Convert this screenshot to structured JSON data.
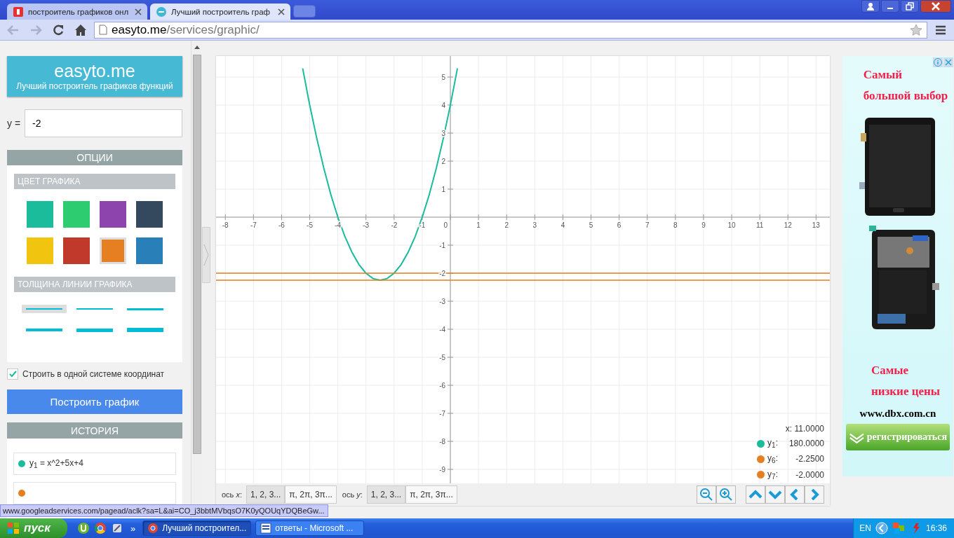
{
  "browser": {
    "tabs": [
      {
        "title": "построитель графиков онл",
        "selected": false
      },
      {
        "title": "Лучший построитель граф",
        "selected": true
      }
    ],
    "url_host": "easyto.me",
    "url_path": "/services/graphic/"
  },
  "sidebar": {
    "logo_title": "easyto.me",
    "logo_subtitle": "Лучший построитель графиков функций",
    "input_label": "y =",
    "input_value": "-2",
    "options_header": "ОПЦИИ",
    "color_header": "ЦВЕТ ГРАФИКА",
    "colors": [
      {
        "color": "#1abc9c",
        "selected": false
      },
      {
        "color": "#2ecc71",
        "selected": false
      },
      {
        "color": "#8e44ad",
        "selected": false
      },
      {
        "color": "#34495e",
        "selected": false
      },
      {
        "color": "#f1c40f",
        "selected": false
      },
      {
        "color": "#c0392b",
        "selected": false
      },
      {
        "color": "#e67e22",
        "selected": true
      },
      {
        "color": "#2980b9",
        "selected": false
      }
    ],
    "thickness_header": "ТОЛЩИНА ЛИНИИ ГРАФИКА",
    "thickness": [
      {
        "selected": true
      },
      {
        "selected": false
      },
      {
        "selected": false
      },
      {
        "selected": false
      },
      {
        "selected": false
      },
      {
        "selected": false
      }
    ],
    "same_axes": {
      "label": "Строить в одной системе координат",
      "checked": true
    },
    "build_button": "Построить график",
    "history_header": "ИСТОРИЯ",
    "history": [
      {
        "label": "y$_{1}$ = x^2+5x+4",
        "color": "#1abc9c"
      },
      {
        "color": "#e67e22"
      }
    ]
  },
  "chart": {
    "chart_data": {
      "type": "line",
      "grid": true,
      "legend": "lower right",
      "x": [
        -8.33,
        -5.25,
        -5,
        -4.75,
        -4.5,
        -4.25,
        -4,
        -3.75,
        -3.5,
        -3.25,
        -3,
        -2.75,
        -2.5,
        -2.25,
        -2,
        -1.75,
        -1.5,
        -1.25,
        -1,
        -0.75,
        -0.5,
        -0.25,
        0,
        0.25,
        13.49
      ],
      "series": [
        {
          "name": "y$_{1}$",
          "color": "#1abc9c",
          "values": [
            null,
            5.31,
            4,
            2.81,
            1.75,
            0.81,
            0,
            -0.69,
            -1.25,
            -1.69,
            -2,
            -2.19,
            -2.25,
            -2.19,
            -2,
            -1.69,
            -1.25,
            -0.69,
            0,
            0.81,
            1.75,
            2.81,
            4,
            5.31,
            null
          ]
        },
        {
          "name": "y$_{6}$",
          "color": "#e67e22",
          "values": [
            -2.25,
            -2.25,
            -2.25,
            -2.25,
            -2.25,
            -2.25,
            -2.25,
            -2.25,
            -2.25,
            -2.25,
            -2.25,
            -2.25,
            -2.25,
            -2.25,
            -2.25,
            -2.25,
            -2.25,
            -2.25,
            -2.25,
            -2.25,
            -2.25,
            -2.25,
            -2.25,
            -2.25,
            -2.25
          ]
        },
        {
          "name": "y$_{7}$",
          "color": "#e67e22",
          "values": [
            -2,
            -2,
            -2,
            -2,
            -2,
            -2,
            -2,
            -2,
            -2,
            -2,
            -2,
            -2,
            -2,
            -2,
            -2,
            -2,
            -2,
            -2,
            -2,
            -2,
            -2,
            -2,
            -2,
            -2,
            -2
          ]
        }
      ],
      "xlim": [
        -8.33,
        13.49
      ],
      "ylim": [
        -9.5,
        5.75
      ],
      "xticks": [
        -8,
        -7,
        -6,
        -5,
        -4,
        -3,
        -2,
        -1,
        0,
        1,
        2,
        3,
        4,
        5,
        6,
        7,
        8,
        9,
        10,
        11,
        12,
        13
      ],
      "yticks": [
        -9,
        -8,
        -7,
        -6,
        -5,
        -4,
        -3,
        -2,
        -1,
        1,
        2,
        3,
        4,
        5
      ]
    },
    "readout": {
      "x": "x: 11.0000",
      "rows": [
        {
          "suffix": ":",
          "value": "180.0000"
        },
        {
          "suffix": ":",
          "value": "-2.2500"
        },
        {
          "suffix": ":",
          "value": "-2.0000"
        }
      ]
    },
    "axes": [
      {
        "label": "ось *x*:",
        "options": [
          {
            "label": "1, 2, 3...",
            "selected": true
          },
          {
            "label": "π, 2π, 3π...",
            "selected": false
          }
        ]
      },
      {
        "label": "ось *y*:",
        "options": [
          {
            "label": "1, 2, 3...",
            "selected": true
          },
          {
            "label": "π, 2π, 3π...",
            "selected": false
          }
        ]
      }
    ]
  },
  "ad": {
    "top_lines": [
      "Самый",
      "большой выбор"
    ],
    "bottom_lines": [
      "Самые",
      "низкие цены"
    ],
    "site": "www.dbx.com.cn",
    "button": "регистрироваться"
  },
  "status_url": "www.googleadservices.com/pagead/aclk?sa=L&ai=CO_j3bbtMVbqsO7K0yQOUqYDQBeGw...",
  "taskbar": {
    "start": "пуск",
    "overflow": "»",
    "tasks": [
      {
        "label": "Лучший построител...",
        "selected": true
      },
      {
        "label": "ответы - Microsoft ...",
        "selected": false
      }
    ],
    "lang": "EN",
    "clock": "16:36"
  }
}
